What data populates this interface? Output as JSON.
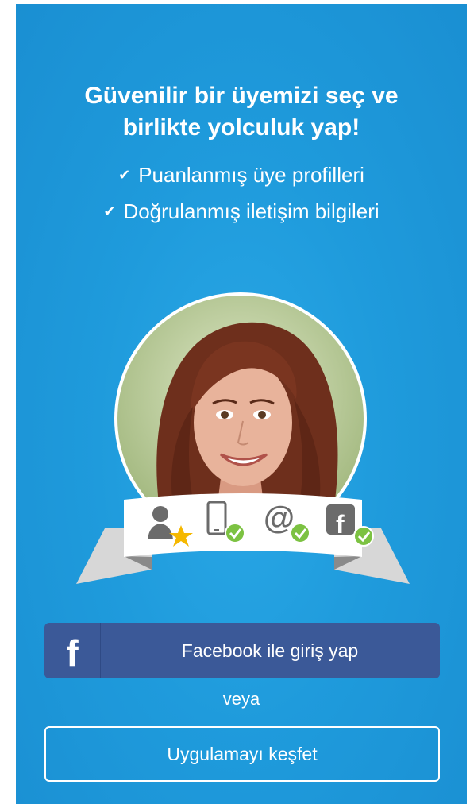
{
  "headline": {
    "line1": "Güvenilir bir üyemizi seç ve",
    "line2": "birlikte yolculuk yap!"
  },
  "features": [
    {
      "text": "Puanlanmış üye profilleri"
    },
    {
      "text": "Doğrulanmış iletişim bilgileri"
    }
  ],
  "badges": [
    {
      "icon": "rated-member-icon"
    },
    {
      "icon": "phone-verified-icon"
    },
    {
      "icon": "email-verified-icon"
    },
    {
      "icon": "facebook-verified-icon"
    }
  ],
  "facebook_button": {
    "icon": "f",
    "label": "Facebook ile giriş yap"
  },
  "separator": "veya",
  "explore_button": {
    "label": "Uygulamayı keşfet"
  },
  "colors": {
    "background": "#1f9bdc",
    "facebook": "#3b5998",
    "verified_green": "#7cc242",
    "star": "#f5b800"
  }
}
